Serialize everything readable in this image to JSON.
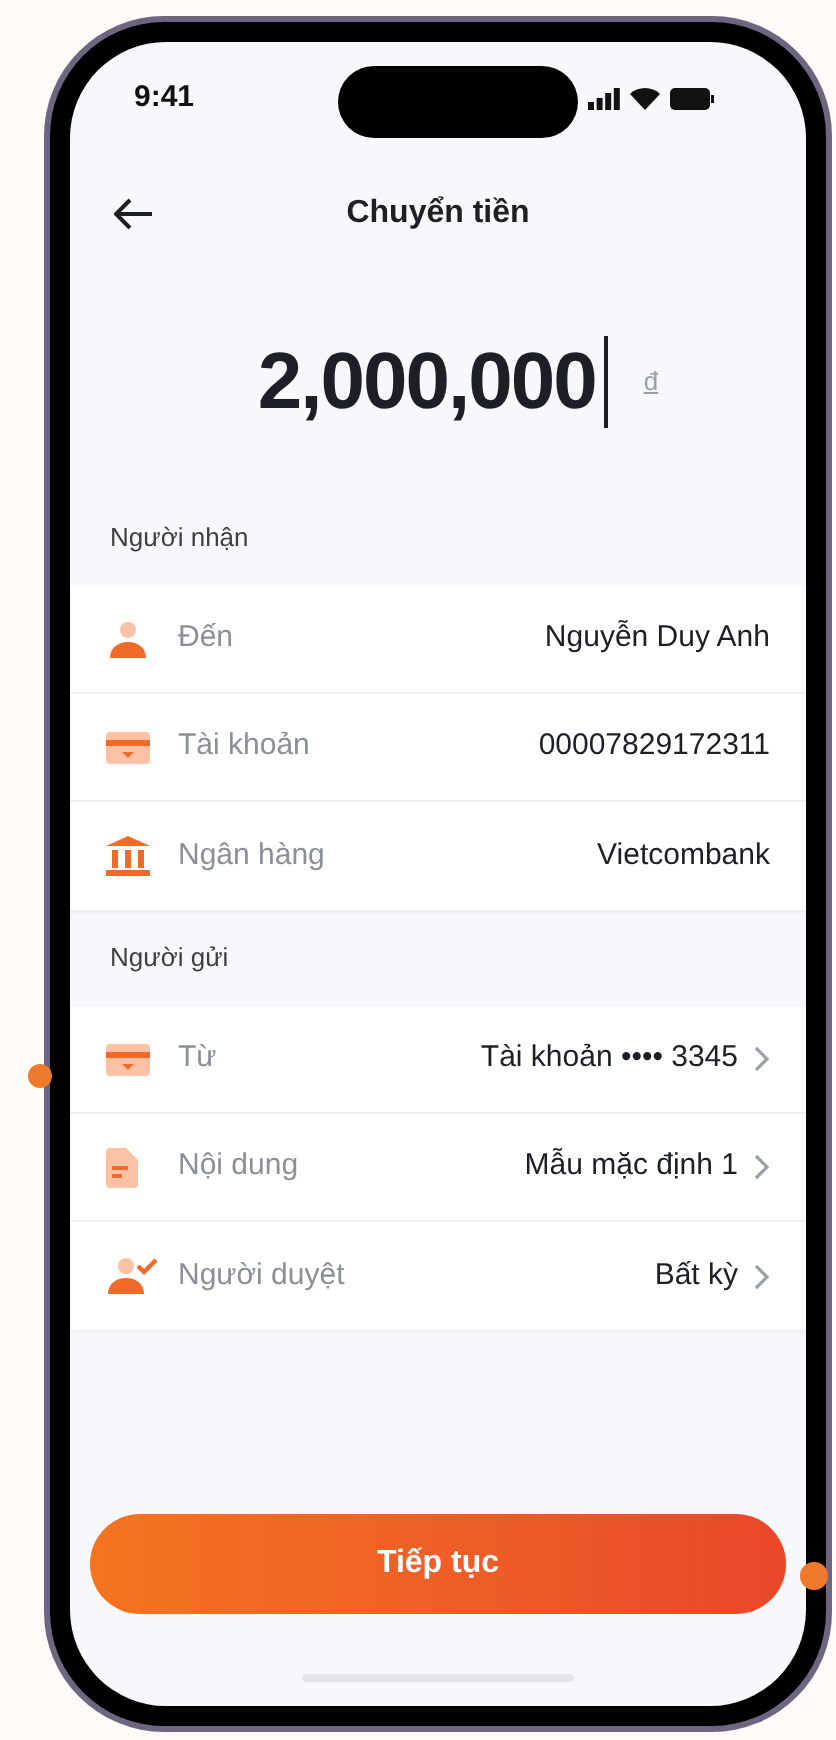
{
  "status_bar": {
    "time": "9:41"
  },
  "header": {
    "title": "Chuyển tiền"
  },
  "amount": {
    "value": "2,000,000",
    "currency": "đ"
  },
  "sections": [
    {
      "title": "Người nhận",
      "rows": [
        {
          "label": "Đến",
          "value": "Nguyễn Duy Anh",
          "kind": "info"
        },
        {
          "label": "Tài khoản",
          "value": "00007829172311",
          "kind": "info"
        },
        {
          "label": "Ngân hàng",
          "value": "Vietcombank",
          "kind": "info"
        }
      ]
    },
    {
      "title": "Người gửi",
      "rows": [
        {
          "label": "Từ",
          "value": "Tài khoản •••• 3345",
          "kind": "nav"
        },
        {
          "label": "Nội dung",
          "value": "Mẫu mặc định 1",
          "kind": "nav"
        },
        {
          "label": "Người duyệt",
          "value": "Bất kỳ",
          "kind": "nav"
        }
      ]
    }
  ],
  "primary_button": {
    "label": "Tiếp tục"
  }
}
